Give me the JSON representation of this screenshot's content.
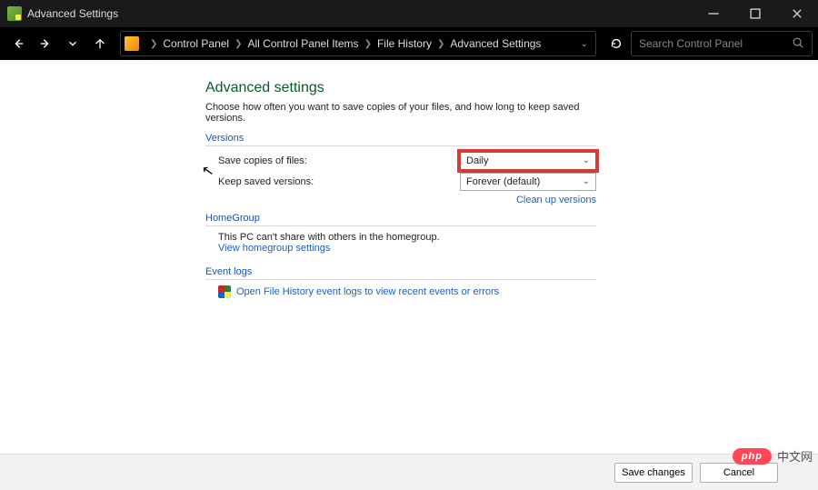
{
  "window": {
    "title": "Advanced Settings"
  },
  "nav": {
    "breadcrumbs": [
      "Control Panel",
      "All Control Panel Items",
      "File History",
      "Advanced Settings"
    ],
    "search_placeholder": "Search Control Panel"
  },
  "page": {
    "heading": "Advanced settings",
    "description": "Choose how often you want to save copies of your files, and how long to keep saved versions."
  },
  "versions": {
    "section": "Versions",
    "save_label": "Save copies of files:",
    "save_value": "Daily",
    "keep_label": "Keep saved versions:",
    "keep_value": "Forever (default)",
    "cleanup_link": "Clean up versions"
  },
  "homegroup": {
    "section": "HomeGroup",
    "text": "This PC can't share with others in the homegroup.",
    "link": "View homegroup settings"
  },
  "eventlogs": {
    "section": "Event logs",
    "link": "Open File History event logs to view recent events or errors"
  },
  "footer": {
    "save": "Save changes",
    "cancel": "Cancel"
  },
  "watermark": {
    "pill": "php",
    "text": "中文网"
  }
}
